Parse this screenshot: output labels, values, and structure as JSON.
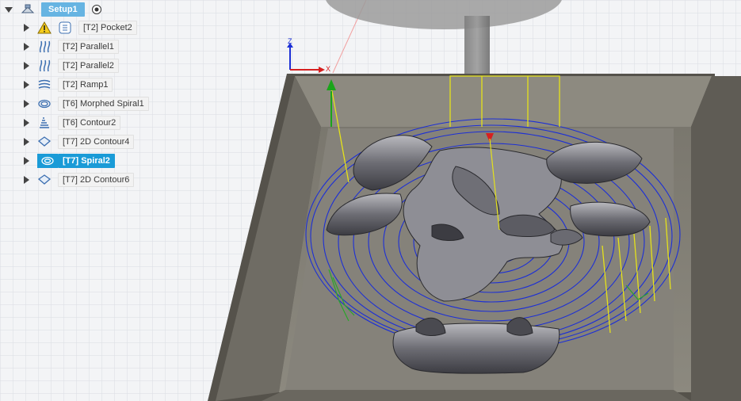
{
  "colors": {
    "selection": "#1a9bd7",
    "setup_highlight": "#66b4e2",
    "toolpath_cut": "#1c2fd6",
    "toolpath_rapid": "#e5e21a",
    "toolpath_lead": "#2aa52a",
    "stock": "#807d74",
    "axis_x": "#d62020",
    "axis_y": "#1aa51a",
    "axis_z": "#1c2fd6"
  },
  "browser": {
    "setup": {
      "label": "Setup1",
      "icon": "setup-icon",
      "visibility_icon": "radio-target-icon"
    },
    "operations": [
      {
        "label": "[T2] Pocket2",
        "icon": "pocket-icon",
        "warning": true,
        "selected": false
      },
      {
        "label": "[T2] Parallel1",
        "icon": "parallel-icon",
        "warning": false,
        "selected": false
      },
      {
        "label": "[T2] Parallel2",
        "icon": "parallel-icon",
        "warning": false,
        "selected": false
      },
      {
        "label": "[T2] Ramp1",
        "icon": "ramp-icon",
        "warning": false,
        "selected": false
      },
      {
        "label": "[T6] Morphed Spiral1",
        "icon": "morphed-spiral-icon",
        "warning": false,
        "selected": false
      },
      {
        "label": "[T6] Contour2",
        "icon": "contour-icon",
        "warning": false,
        "selected": false
      },
      {
        "label": "[T7] 2D Contour4",
        "icon": "2d-contour-icon",
        "warning": false,
        "selected": false
      },
      {
        "label": "[T7] Spiral2",
        "icon": "spiral-icon",
        "warning": false,
        "selected": true
      },
      {
        "label": "[T7] 2D Contour6",
        "icon": "2d-contour-icon",
        "warning": false,
        "selected": false
      }
    ]
  },
  "viewcube_axes": {
    "z": "Z",
    "x": "X"
  }
}
